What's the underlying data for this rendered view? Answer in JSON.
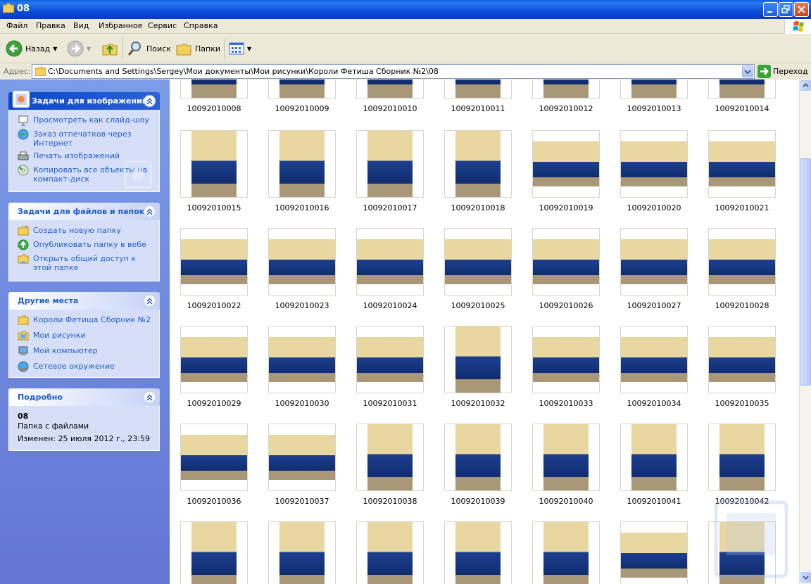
{
  "window": {
    "title": "08"
  },
  "menu": [
    "Файл",
    "Правка",
    "Вид",
    "Избранное",
    "Сервис",
    "Справка"
  ],
  "toolbar": {
    "back": "Назад",
    "search": "Поиск",
    "folders": "Папки"
  },
  "address": {
    "label": "Адрес:",
    "path": "C:\\Documents and Settings\\Sergey\\Мои документы\\Мои рисунки\\Короли Фетиша Сборник №2\\08",
    "go": "Переход"
  },
  "image_tasks": {
    "title": "Задачи для изображений",
    "items": [
      "Просмотреть как слайд-шоу",
      "Заказ отпечатков через Интернет",
      "Печать изображений",
      "Копировать все объекты на компакт-диск"
    ]
  },
  "file_tasks": {
    "title": "Задачи для файлов и папок",
    "items": [
      "Создать новую папку",
      "Опубликовать папку в вебе",
      "Открыть общий доступ к этой папке"
    ]
  },
  "other_places": {
    "title": "Другие места",
    "items": [
      "Короли Фетиша Сборник №2",
      "Мои рисунки",
      "Мой компьютер",
      "Сетевое окружение"
    ]
  },
  "details": {
    "title": "Подробно",
    "name": "08",
    "type": "Папка с файлами",
    "modified": "Изменен: 25 июля 2012 г., 23:59"
  },
  "files": [
    "10092010008",
    "10092010009",
    "10092010010",
    "10092010011",
    "10092010012",
    "10092010013",
    "10092010014",
    "10092010015",
    "10092010016",
    "10092010017",
    "10092010018",
    "10092010019",
    "10092010020",
    "10092010021",
    "10092010022",
    "10092010023",
    "10092010024",
    "10092010025",
    "10092010026",
    "10092010027",
    "10092010028",
    "10092010029",
    "10092010030",
    "10092010031",
    "10092010032",
    "10092010033",
    "10092010034",
    "10092010035",
    "10092010036",
    "10092010037",
    "10092010038",
    "10092010039",
    "10092010040",
    "10092010041",
    "10092010042",
    "",
    "",
    "",
    "",
    "",
    "",
    ""
  ],
  "orientations": [
    "P",
    "P",
    "P",
    "P",
    "P",
    "P",
    "P",
    "P",
    "P",
    "P",
    "P",
    "L",
    "L",
    "L",
    "L",
    "L",
    "L",
    "L",
    "L",
    "L",
    "L",
    "L",
    "L",
    "L",
    "P",
    "L",
    "L",
    "L",
    "L",
    "L",
    "P",
    "P",
    "P",
    "P",
    "P",
    "P",
    "P",
    "P",
    "P",
    "P",
    "L",
    "P"
  ],
  "colors": {
    "sofa": "#1c3f8f",
    "wall": "#e8d7a0",
    "accent": "#215dc6"
  }
}
